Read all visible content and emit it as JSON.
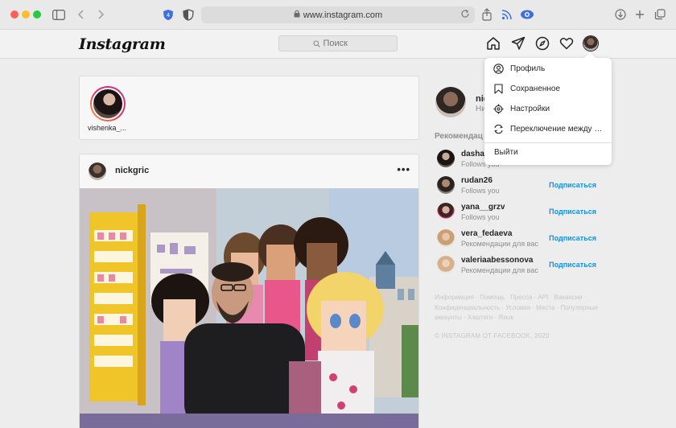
{
  "browser": {
    "url": "www.instagram.com"
  },
  "header": {
    "logo": "Instagram",
    "search_placeholder": "Поиск"
  },
  "stories": [
    {
      "username": "vishenka_..."
    }
  ],
  "post": {
    "username": "nickgric",
    "more": "•••"
  },
  "sidebar": {
    "me_name": "nic",
    "me_sub": "Ни",
    "recommendations_title": "Рекомендац",
    "suggestions": [
      {
        "username": "dasha_",
        "subtitle": "Follows you",
        "follow": ""
      },
      {
        "username": "rudan26",
        "subtitle": "Follows you",
        "follow": "Подписаться"
      },
      {
        "username": "yana__grzv",
        "subtitle": "Follows you",
        "follow": "Подписаться"
      },
      {
        "username": "vera_fedaeva",
        "subtitle": "Рекомендации для вас",
        "follow": "Подписаться"
      },
      {
        "username": "valeriaabessonova",
        "subtitle": "Рекомендации для вас",
        "follow": "Подписаться"
      }
    ],
    "footer_links": "Информация · Помощь · Пресса · API · Вакансии · Конфиденциальность · Условия · Места · Популярные аккаунты · Хэштеги · Язык",
    "footer_copy": "© INSTAGRAM OT FACEBOOK, 2020"
  },
  "dropdown": {
    "items": [
      {
        "label": "Профиль",
        "icon": "user-circle-icon"
      },
      {
        "label": "Сохраненное",
        "icon": "bookmark-icon"
      },
      {
        "label": "Настройки",
        "icon": "gear-icon"
      },
      {
        "label": "Переключение между аккаунтами",
        "icon": "switch-account-icon"
      }
    ],
    "logout": "Выйти"
  },
  "colors": {
    "accent": "#0095f6",
    "story_ring_start": "#f7a437",
    "story_ring_end": "#c13584"
  }
}
